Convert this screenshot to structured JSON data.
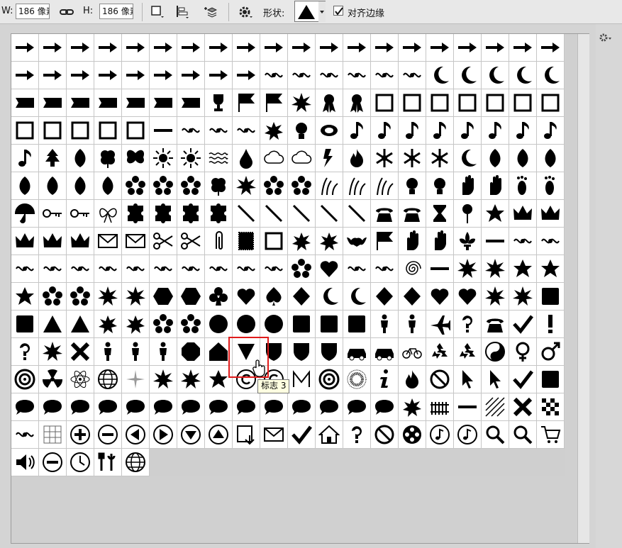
{
  "optbar": {
    "w_label": "W:",
    "w_value": "186 像素",
    "link_icon": "link-icon",
    "h_label": "H:",
    "h_value": "186 像素",
    "shape_label": "形状:",
    "align_checkbox_checked": true,
    "align_label": "对齐边缘"
  },
  "picker": {
    "tooltip": "标志 3",
    "selected_index": 226,
    "selection_color": "#e01b1b"
  },
  "shapes": [
    "arrow",
    "arrow",
    "arrow",
    "arrow",
    "arrow",
    "arrow",
    "arrow",
    "arrow",
    "arrow",
    "arrow",
    "arrow",
    "arrow",
    "arrow",
    "arrow",
    "arrow",
    "arrow",
    "arrow",
    "arrow",
    "arrow",
    "arrow",
    "arrow",
    "arrow",
    "arrow",
    "arrow",
    "arrow",
    "arrow",
    "arrow",
    "arrow",
    "arrow",
    "ornament",
    "ornament",
    "ornament",
    "ornament",
    "ornament",
    "ornament",
    "crescent",
    "crescent",
    "crescent",
    "crescent",
    "crescent",
    "banner",
    "banner",
    "banner",
    "banner",
    "banner",
    "banner",
    "banner",
    "trophy",
    "flag",
    "flag",
    "starburst",
    "ribbon",
    "ribbon",
    "frame",
    "frame",
    "frame",
    "frame",
    "frame",
    "frame",
    "frame",
    "frame",
    "frame",
    "frame",
    "frame",
    "frame",
    "line",
    "ornament",
    "ornament",
    "ornament",
    "splat",
    "bulb",
    "ellipse",
    "note",
    "note",
    "note",
    "note",
    "note",
    "note",
    "note",
    "note",
    "note",
    "tree",
    "leaf",
    "clover",
    "butterfly",
    "sun",
    "sun",
    "waves",
    "drop",
    "cloud",
    "cloud",
    "bolt",
    "fire",
    "snowflake",
    "snowflake",
    "snowflake",
    "crescent",
    "leaf",
    "leaf",
    "leaf",
    "leaf",
    "leaf",
    "leaf",
    "leaf",
    "flower",
    "flower",
    "flower",
    "clover",
    "starburst",
    "flower",
    "flower",
    "grass",
    "grass",
    "grass",
    "bulb",
    "bulb",
    "hand",
    "hand",
    "foot",
    "foot",
    "umbrella",
    "key",
    "key",
    "bow",
    "puzzle",
    "puzzle",
    "puzzle",
    "puzzle",
    "pencil",
    "pencil",
    "pencil",
    "pencil",
    "pencil",
    "phone",
    "phone",
    "hourglass",
    "pin",
    "star",
    "crown",
    "crown",
    "crown",
    "crown",
    "crown",
    "envelope",
    "envelope",
    "scissors",
    "scissors",
    "clip",
    "stamp",
    "frame",
    "splat",
    "splat",
    "bat",
    "flag",
    "hand",
    "hand",
    "fleur",
    "line",
    "ornament",
    "ornament",
    "ornament",
    "ornament",
    "ornament",
    "ornament",
    "ornament",
    "ornament",
    "ornament",
    "ornament",
    "ornament",
    "ornament",
    "flower",
    "heart",
    "ornament",
    "ornament",
    "spiral",
    "line",
    "starburst",
    "starburst",
    "star",
    "star",
    "star",
    "flower",
    "flower",
    "starburst",
    "starburst",
    "hexagon",
    "hexagon",
    "club",
    "heart",
    "spade",
    "diamond",
    "crescent",
    "crescent",
    "diamond",
    "diamond",
    "heart",
    "heart",
    "starburst",
    "starburst",
    "square",
    "square",
    "triangle",
    "triangle",
    "splat",
    "splat",
    "flower",
    "flower",
    "circle",
    "circle",
    "circle",
    "square",
    "square",
    "square",
    "person",
    "person",
    "plane",
    "question",
    "phone",
    "check",
    "exclaim",
    "question",
    "starburst",
    "cross",
    "person",
    "person",
    "person",
    "octagon",
    "pentagon",
    "triangle-down",
    "shield",
    "shield",
    "shield",
    "car",
    "car",
    "bicycle",
    "recycle",
    "recycle",
    "yinyang",
    "female",
    "male",
    "target",
    "radiation",
    "atom",
    "globe",
    "compass",
    "starburst",
    "starburst",
    "star",
    "copyright",
    "copyright",
    "letter",
    "target",
    "sunburst",
    "info",
    "fire",
    "no",
    "cursor",
    "cursor",
    "check",
    "square",
    "bubble",
    "bubble",
    "bubble",
    "bubble",
    "bubble",
    "bubble",
    "bubble",
    "bubble",
    "bubble",
    "bubble",
    "bubble",
    "bubble",
    "bubble",
    "bubble",
    "splat",
    "fence",
    "line",
    "hatch",
    "cross",
    "checker",
    "ornament",
    "grid",
    "plus",
    "minus",
    "left",
    "right",
    "down",
    "up",
    "save",
    "envelope",
    "check",
    "home",
    "question",
    "no",
    "film",
    "music",
    "music",
    "search",
    "search",
    "cart",
    "speaker",
    "minus",
    "clock",
    "tools",
    "globe"
  ]
}
